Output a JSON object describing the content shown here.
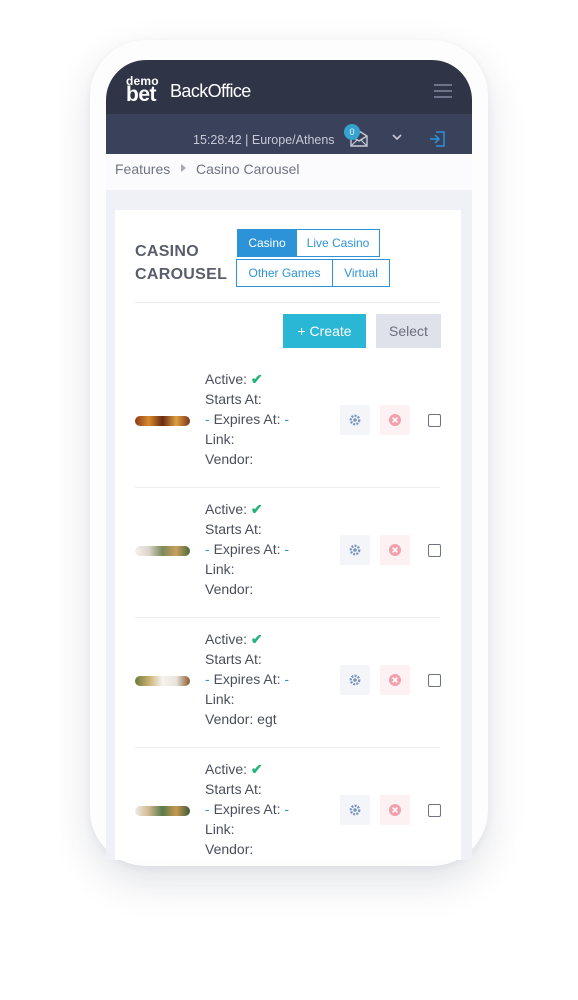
{
  "header": {
    "logo_top": "demo",
    "logo_bottom": "bet",
    "app_title": "BackOffice",
    "menu_icon": "hamburger-icon"
  },
  "subbar": {
    "clock": "15:28:42 | Europe/Athens",
    "mail_badge": "0",
    "mail_icon": "envelope-icon",
    "dropdown_icon": "chevron-down-icon",
    "logout_icon": "logout-icon"
  },
  "breadcrumb": {
    "items": [
      "Features",
      "Casino Carousel"
    ]
  },
  "card": {
    "title_line1": "CASINO",
    "title_line2": "CAROUSEL"
  },
  "tabs": [
    {
      "label": "Casino",
      "active": true
    },
    {
      "label": "Live Casino",
      "active": false
    },
    {
      "label": "Other Games",
      "active": false
    },
    {
      "label": "Virtual",
      "active": false
    }
  ],
  "actions": {
    "create_label": "+ Create",
    "select_label": "Select"
  },
  "labels": {
    "active": "Active:",
    "starts_at": "Starts At:",
    "expires_at": "Expires At:",
    "link": "Link:",
    "vendor": "Vendor:",
    "empty_value": "-"
  },
  "rows": [
    {
      "active": true,
      "vendor": ""
    },
    {
      "active": true,
      "vendor": ""
    },
    {
      "active": true,
      "vendor": "egt"
    },
    {
      "active": true,
      "vendor": ""
    }
  ],
  "colors": {
    "topbar": "#2f3446",
    "subbar": "#3a415a",
    "accent": "#2d93d8",
    "create_button": "#2ab7d6",
    "active_check": "#25b37a",
    "delete_icon": "#f2a0ac"
  }
}
